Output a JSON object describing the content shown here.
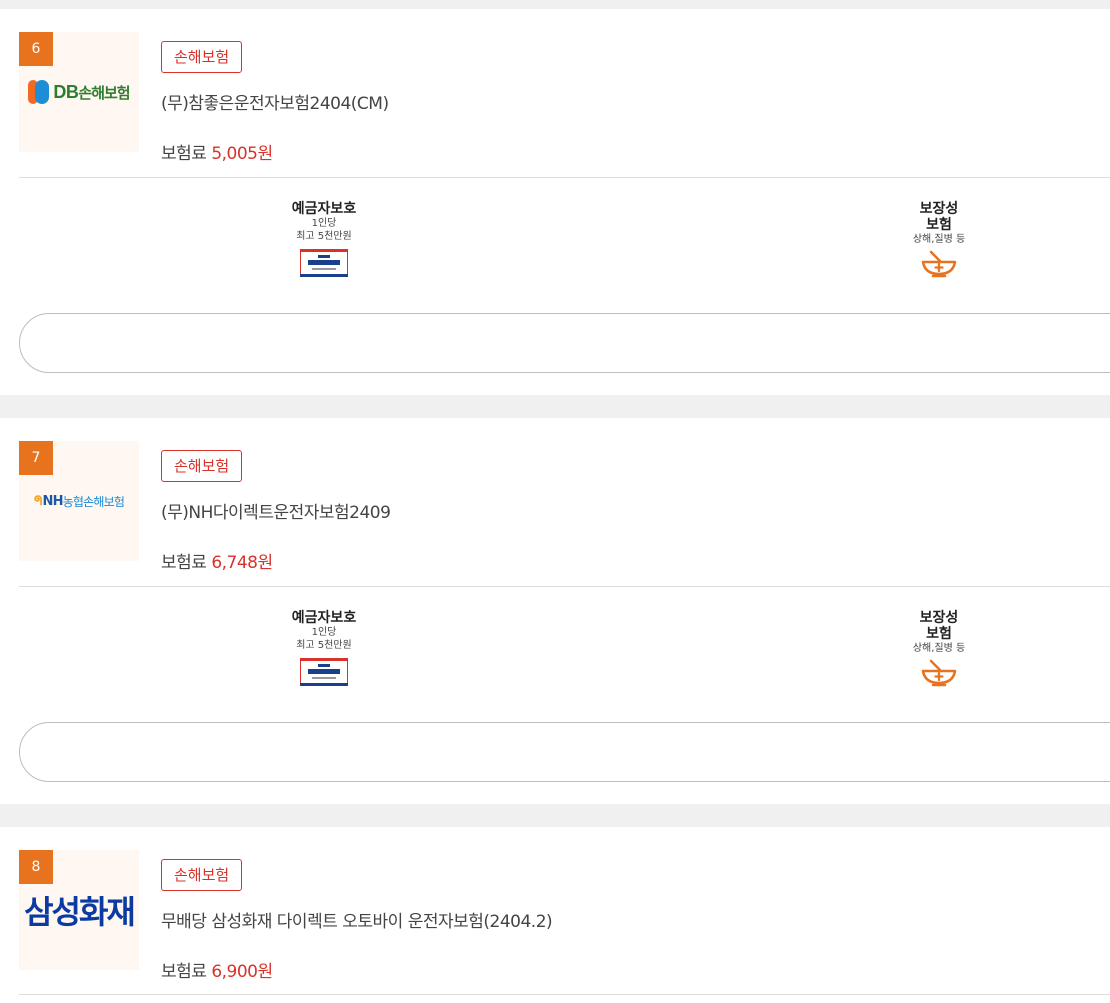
{
  "items": [
    {
      "rank": "6",
      "logo": {
        "icon": "db-insurance-logo",
        "text_main": "DB",
        "text_sub": "손해보험"
      },
      "category": "손해보험",
      "product_name": "(무)참좋은운전자보험2404(CM)",
      "premium_label": "보험료",
      "premium_value": "5,005원",
      "features": {
        "deposit": {
          "title": "예금자보호",
          "line1": "1인당",
          "line2": "최고 5천만원",
          "icon": "kdic-protection-badge-icon"
        },
        "coverage": {
          "title1": "보장성",
          "title2": "보험",
          "line1": "상해,질병 등",
          "icon": "medicine-bowl-icon"
        }
      }
    },
    {
      "rank": "7",
      "logo": {
        "icon": "nh-insurance-logo",
        "text_main": "NH",
        "text_sub": "농협손해보험"
      },
      "category": "손해보험",
      "product_name": "(무)NH다이렉트운전자보험2409",
      "premium_label": "보험료",
      "premium_value": "6,748원",
      "features": {
        "deposit": {
          "title": "예금자보호",
          "line1": "1인당",
          "line2": "최고 5천만원",
          "icon": "kdic-protection-badge-icon"
        },
        "coverage": {
          "title1": "보장성",
          "title2": "보험",
          "line1": "상해,질병 등",
          "icon": "medicine-bowl-icon"
        }
      }
    },
    {
      "rank": "8",
      "logo": {
        "icon": "samsung-fire-logo",
        "text_main": "삼성화재"
      },
      "category": "손해보험",
      "product_name": "무배당 삼성화재 다이렉트 오토바이 운전자보험(2404.2)",
      "premium_label": "보험료",
      "premium_value": "6,900원"
    }
  ],
  "colors": {
    "rank_bg": "#e8731f",
    "accent_red": "#d9322a",
    "logo_bg": "#fff7f1",
    "page_bg": "#f0f0f0"
  }
}
